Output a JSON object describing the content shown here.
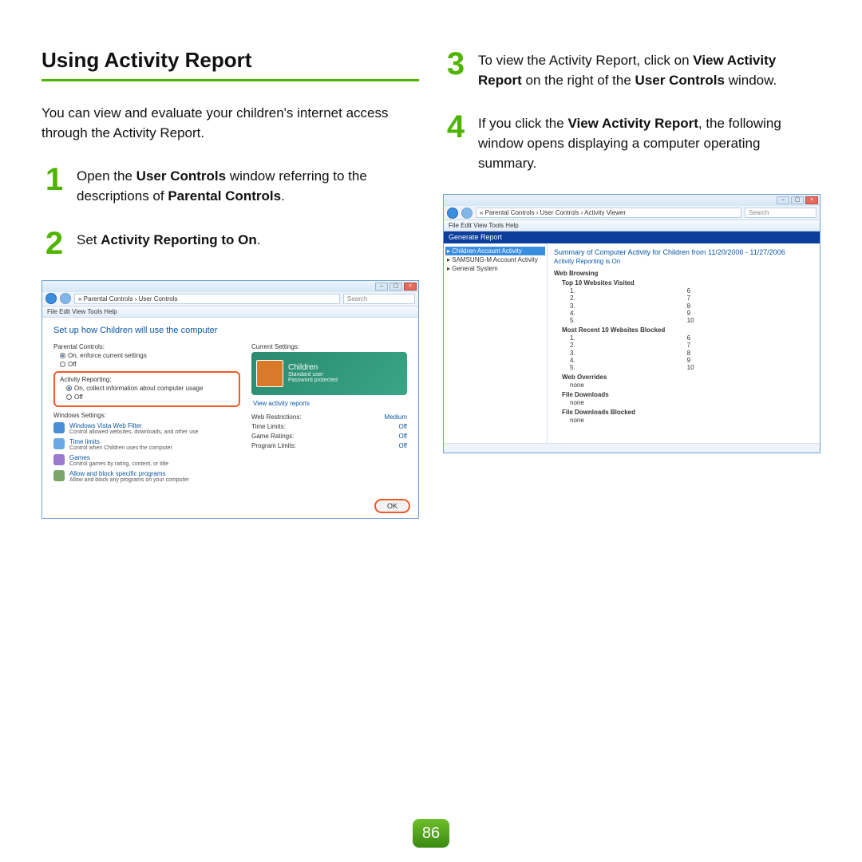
{
  "heading": "Using Activity Report",
  "intro": "You can view and evaluate your children's internet access through the Activity Report.",
  "steps": {
    "1": {
      "pre": "Open the ",
      "b1": "User Controls",
      "mid": " window referring to the descriptions of ",
      "b2": "Parental Controls",
      "post": "."
    },
    "2": {
      "pre": "Set ",
      "b1": "Activity Reporting to On",
      "post": "."
    },
    "3": {
      "pre": "To view the Activity Report, click on ",
      "b1": "View Activity Report",
      "mid": " on the right of the ",
      "b2": "User Controls",
      "post": " window."
    },
    "4": {
      "pre": "If you click the ",
      "b1": "View Activity Report",
      "post": ", the following window opens displaying a computer operating summary."
    }
  },
  "page_number": "86",
  "shot1": {
    "breadcrumb": "«  Parental Controls  ›  User Controls",
    "search_placeholder": "Search",
    "menu": "File   Edit   View   Tools   Help",
    "header": "Set up how Children will use the computer",
    "pc_label": "Parental Controls:",
    "pc_on": "On, enforce current settings",
    "pc_off": "Off",
    "ar_label": "Activity Reporting:",
    "ar_on": "On, collect information about computer usage",
    "ar_off": "Off",
    "ws_label": "Windows Settings:",
    "filter": {
      "t": "Windows Vista Web Filter",
      "d": "Control allowed websites, downloads, and other use"
    },
    "time": {
      "t": "Time limits",
      "d": "Control when Children uses the computer"
    },
    "games": {
      "t": "Games",
      "d": "Control games by rating, content, or title"
    },
    "allow": {
      "t": "Allow and block specific programs",
      "d": "Allow and block any programs on your computer"
    },
    "cs_label": "Current Settings:",
    "card": {
      "name": "Children",
      "role": "Standard user",
      "prot": "Password protected"
    },
    "view_link": "View activity reports",
    "cs": {
      "web": {
        "k": "Web Restrictions:",
        "v": "Medium"
      },
      "time": {
        "k": "Time Limits:",
        "v": "Off"
      },
      "game": {
        "k": "Game Ratings:",
        "v": "Off"
      },
      "prog": {
        "k": "Program Limits:",
        "v": "Off"
      }
    },
    "ok": "OK"
  },
  "shot2": {
    "breadcrumb": "«  Parental Controls  ›  User Controls  ›  Activity Viewer",
    "search_placeholder": "Search",
    "menu": "File   Edit   View   Tools   Help",
    "gen": "Generate Report",
    "tree": {
      "a": "Children Account Activity",
      "b": "SAMSUNG-M Account Activity",
      "c": "General System"
    },
    "rep_title": "Summary of Computer Activity for Children from 11/20/2006 - 11/27/2006",
    "rep_sub": "Activity Reporting is On",
    "sec_web": "Web Browsing",
    "top": "Top 10 Websites Visited",
    "left": {
      "a": "1.",
      "b": "2.",
      "c": "3.",
      "d": "4.",
      "e": "5."
    },
    "right": {
      "a": "6",
      "b": "7",
      "c": "8",
      "d": "9",
      "e": "10"
    },
    "blocked": "Most Recent 10 Websites Blocked",
    "over": "Web Overrides",
    "none": "none",
    "dl": "File Downloads",
    "dlb": "File Downloads Blocked"
  }
}
